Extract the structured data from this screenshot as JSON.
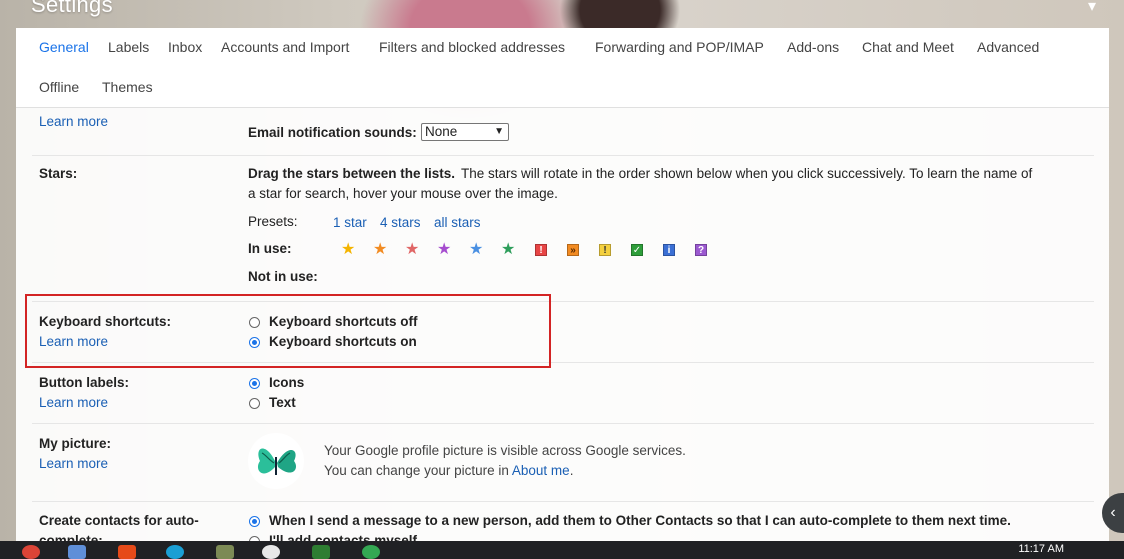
{
  "header": {
    "title": "Settings",
    "menu_glyph": "▾"
  },
  "tabs": [
    {
      "label": "General",
      "active": true
    },
    {
      "label": "Labels"
    },
    {
      "label": "Inbox"
    },
    {
      "label": "Accounts and Import"
    },
    {
      "label": "Filters and blocked addresses"
    },
    {
      "label": "Forwarding and POP/IMAP"
    },
    {
      "label": "Add-ons"
    },
    {
      "label": "Chat and Meet"
    },
    {
      "label": "Advanced"
    },
    {
      "label": "Offline"
    },
    {
      "label": "Themes"
    }
  ],
  "notifications": {
    "learn_more": "Learn more",
    "sounds_label": "Email notification sounds:",
    "sounds_value": "None"
  },
  "stars": {
    "label": "Stars:",
    "desc_bold": "Drag the stars between the lists.",
    "desc_line1": " The stars will rotate in the order shown below when you click successively. To learn the name of",
    "desc_line2": "a star for search, hover your mouse over the image.",
    "presets_label": "Presets:",
    "preset_1": "1 star",
    "preset_4": "4 stars",
    "preset_all": "all stars",
    "in_use_label": "In use:",
    "not_in_use_label": "Not in use:",
    "star_colors": [
      "#f4b400",
      "#f28b22",
      "#e06666",
      "#a64dcf",
      "#4a90e2",
      "#2e9e5b"
    ],
    "icon_glyphs": [
      "!",
      "»",
      "!",
      "✓",
      "i",
      "?"
    ],
    "icon_colors": [
      "#e84545",
      "#f28b22",
      "#f4d03f",
      "#2e9e3a",
      "#3b6fd4",
      "#9b59d0"
    ]
  },
  "keyboard": {
    "label": "Keyboard shortcuts:",
    "learn_more": "Learn more",
    "option_off": "Keyboard shortcuts off",
    "option_on": "Keyboard shortcuts on"
  },
  "buttons": {
    "label": "Button labels:",
    "learn_more": "Learn more",
    "option_icons": "Icons",
    "option_text": "Text"
  },
  "picture": {
    "label": "My picture:",
    "learn_more": "Learn more",
    "line1": "Your Google profile picture is visible across Google services.",
    "line2_prefix": "You can change your picture in ",
    "about_me": "About me",
    "line2_suffix": "."
  },
  "contacts": {
    "label_line1": "Create contacts for auto-",
    "label_line2": "complete:",
    "option_1": "When I send a message to a new person, add them to Other Contacts so that I can auto-complete to them next time.",
    "option_2": "I'll add contacts myself"
  },
  "taskbar": {
    "clock": "11:17 AM"
  }
}
